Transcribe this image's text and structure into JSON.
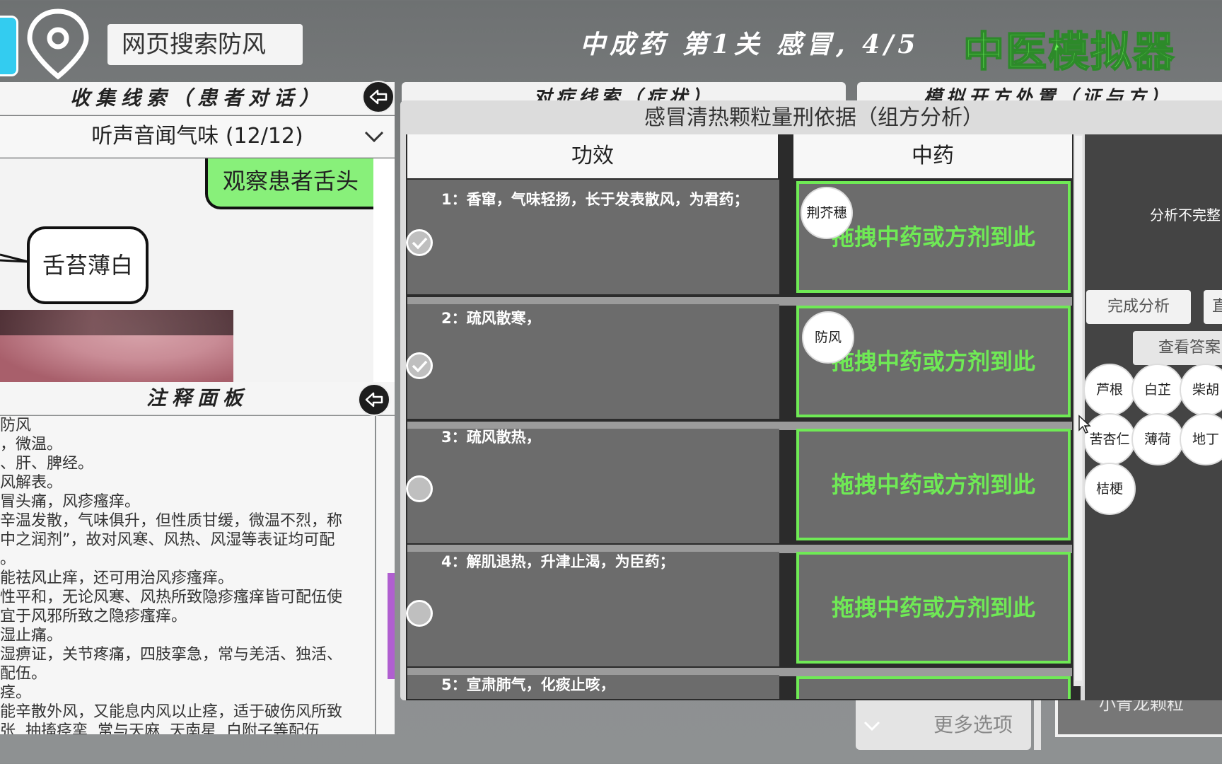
{
  "header": {
    "search_text": "网页搜索防风",
    "level_title": "中成药 第1关 感冒, 4/5",
    "app_title": "中医模拟器"
  },
  "clue_panel": {
    "title": "收集线索（患者对话）",
    "dropdown_label": "听声音闻气味 (12/12)",
    "messages": [
      {
        "from": "player",
        "text": "观察患者舌头"
      },
      {
        "from": "patient",
        "text": "舌苔薄白"
      }
    ]
  },
  "notes_panel": {
    "title": "注释面板",
    "text": "防风\n，微温。\n、肝、脾经。\n风解表。\n冒头痛，风疹瘙痒。\n辛温发散，气味俱升，但性质甘缓，微温不烈，称\n中之润剂”，故对风寒、风热、风湿等表证均可配\n。\n能祛风止痒，还可用治风疹瘙痒。\n性平和，无论风寒、风热所致隐疹瘙痒皆可配伍使\n宜于风邪所致之隐疹瘙痒。\n湿止痛。\n湿痹证，关节疼痛，四肢挛急，常与羌活、独活、\n配伍。\n痉。\n能辛散外风，又能息内风以止痉，适于破伤风所致\n张  抽搐痉挛  常与天麻  天南星  白附子等配伍"
  },
  "mid_tab_title": "对症线索（症状）",
  "right_tab_title": "模拟开方处置（证与方）",
  "analysis": {
    "title": "感冒清热颗粒量刑依据（组方分析）",
    "col_effect": "功效",
    "col_herb": "中药",
    "drop_hint": "拖拽中药或方剂到此",
    "rows": [
      {
        "effect": "1：香窜，气味轻扬，长于发表散风，为君药；",
        "checked": true,
        "herb": "荆芥穗"
      },
      {
        "effect": "2：疏风散寒，",
        "checked": true,
        "herb": "防风"
      },
      {
        "effect": "3：疏风散热，",
        "checked": false,
        "herb": ""
      },
      {
        "effect": "4：解肌退热，升津止渴，为臣药；",
        "checked": false,
        "herb": ""
      },
      {
        "effect": "5：宣肃肺气，化痰止咳，",
        "checked": false,
        "herb": ""
      }
    ]
  },
  "side_panel": {
    "status": "分析不完整",
    "finish_button": "完成分析",
    "second_button": "直",
    "answer_button": "查看答案",
    "herbs": [
      "芦根",
      "白芷",
      "柴胡",
      "苦杏仁",
      "薄荷",
      "地丁",
      "桔梗"
    ]
  },
  "bottom": {
    "more_options": "更多选项",
    "formula": "小青龙颗粒"
  },
  "colors": {
    "accent_green": "#6fea55",
    "bubble_green": "#88f07a",
    "title_green": "#66ee55"
  }
}
